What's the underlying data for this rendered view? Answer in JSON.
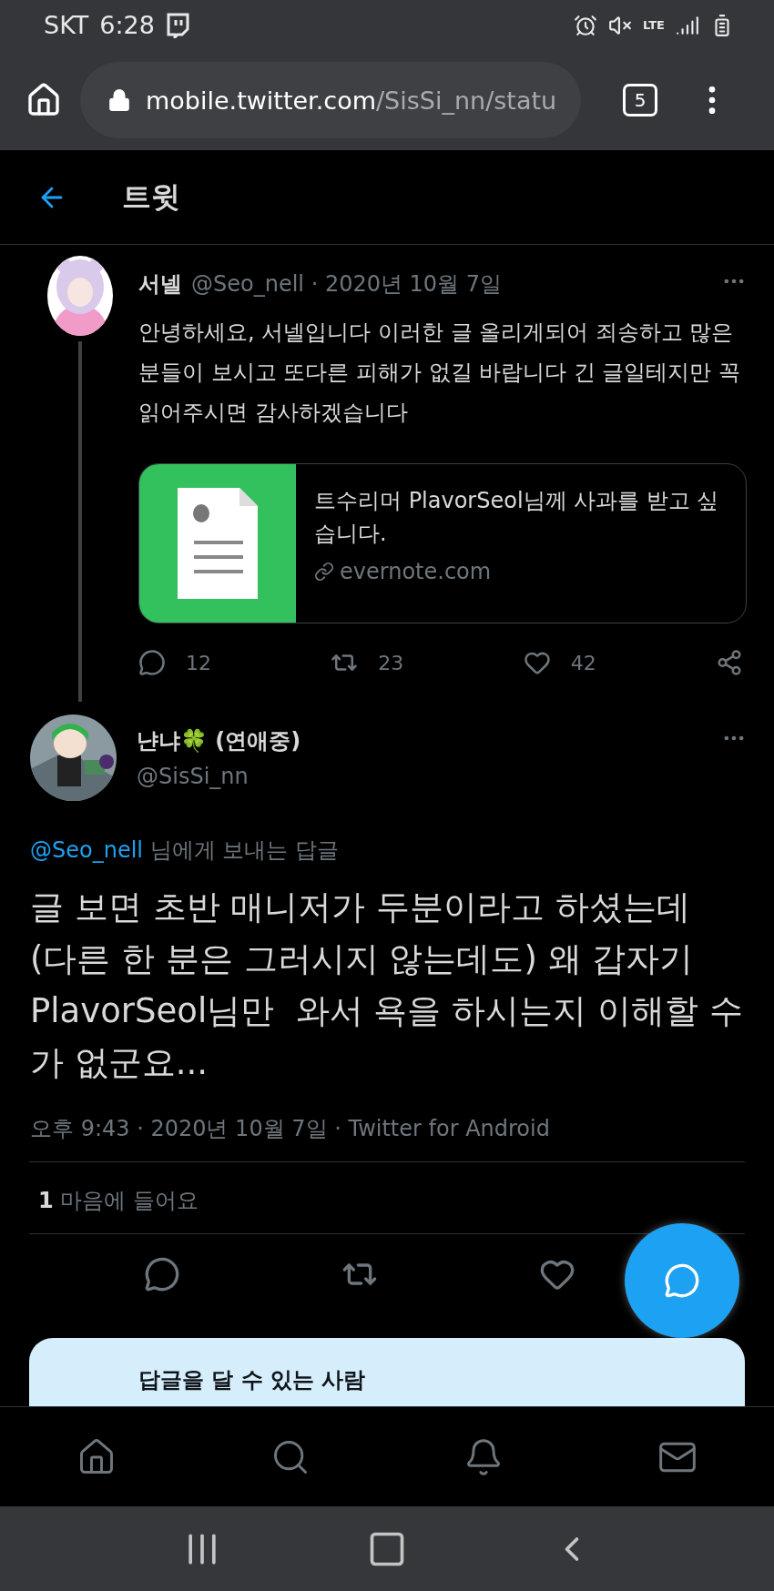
{
  "status_bar": {
    "carrier": "SKT",
    "time": "6:28",
    "network": "LTE"
  },
  "browser": {
    "url_host": "mobile.twitter.com",
    "url_path": "/SisSi_nn/statu",
    "tab_count": "5"
  },
  "header": {
    "title": "트윗"
  },
  "parent_tweet": {
    "name": "서넬",
    "meta": "@Seo_nell · 2020년 10월 7일",
    "text": "안녕하세요, 서넬입니다 이러한 글 올리게되어 죄송하고 많은 분들이 보시고 또다른 피해가 없길 바랍니다 긴 글일테지만 꼭 읽어주시면 감사하겠습니다",
    "card": {
      "title": "트수리머 PlavorSeol님께 사과를 받고 싶습니다.",
      "domain": "evernote.com"
    },
    "actions": [
      {
        "kind": "reply",
        "count": "12"
      },
      {
        "kind": "retweet",
        "count": "23"
      },
      {
        "kind": "like",
        "count": "42"
      },
      {
        "kind": "share"
      }
    ]
  },
  "reply_tweet": {
    "name": "냔냐🍀 (연애중)",
    "handle": "@SisSi_nn",
    "replying_to": {
      "mention": "@Seo_nell",
      "rest": "님에게 보내는 답글"
    },
    "text": "글 보면 초반 매니저가 두분이라고 하셨는데 (다른 한 분은 그러시지 않는데도) 왜 갑자기 PlavorSeol님만  와서 욕을 하시는지 이해할 수가 없군요...",
    "timestamp": "오후 9:43 · 2020년 10월 7일 · Twitter for Android",
    "likes": {
      "count": "1",
      "label": "마음에 들어요"
    },
    "actions": [
      {
        "kind": "reply"
      },
      {
        "kind": "retweet"
      },
      {
        "kind": "like"
      }
    ]
  },
  "reply_settings_card": {
    "title": "답글을 달 수 있는 사람"
  },
  "bottom_nav": [
    {
      "kind": "home"
    },
    {
      "kind": "search"
    },
    {
      "kind": "notifications"
    },
    {
      "kind": "messages"
    }
  ],
  "system_nav": [
    {
      "kind": "recents"
    },
    {
      "kind": "home"
    },
    {
      "kind": "back"
    }
  ]
}
